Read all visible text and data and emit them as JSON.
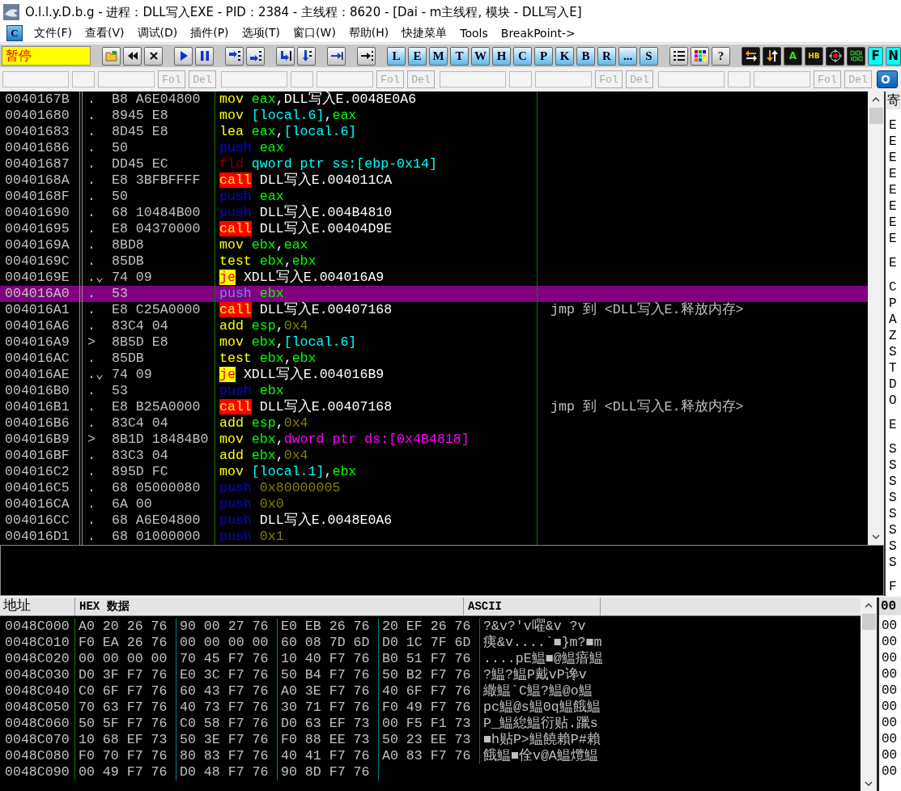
{
  "window": {
    "title": "O.l.l.y.D.b.g - 进程：DLL写入EXE - PID：2384 - 主线程：8620 - [Dai - m主线程, 模块 - DLL写入E]"
  },
  "menu": {
    "logo": "C",
    "items": [
      "文件(F)",
      "查看(V)",
      "调试(D)",
      "插件(P)",
      "选项(T)",
      "窗口(W)",
      "帮助(H)",
      "快捷菜单",
      "Tools",
      "BreakPoint->"
    ]
  },
  "toolbar": {
    "status": "暂停",
    "groups": [
      [
        {
          "kind": "open"
        },
        {
          "kind": "rewind"
        },
        {
          "kind": "close"
        }
      ],
      [
        {
          "kind": "run"
        },
        {
          "kind": "pause"
        }
      ],
      [
        {
          "kind": "step-into"
        },
        {
          "kind": "step-over"
        }
      ],
      [
        {
          "kind": "trace-into"
        },
        {
          "kind": "trace-over"
        }
      ],
      [
        {
          "kind": "till-return"
        }
      ],
      [
        {
          "kind": "goto"
        }
      ],
      [
        {
          "kind": "letter",
          "label": "L"
        },
        {
          "kind": "letter",
          "label": "E"
        },
        {
          "kind": "letter",
          "label": "M"
        },
        {
          "kind": "letter",
          "label": "T"
        },
        {
          "kind": "letter",
          "label": "W"
        },
        {
          "kind": "letter",
          "label": "H"
        },
        {
          "kind": "letter",
          "label": "C"
        },
        {
          "kind": "letter",
          "label": "P"
        },
        {
          "kind": "letter",
          "label": "K"
        },
        {
          "kind": "letter",
          "label": "B"
        },
        {
          "kind": "letter",
          "label": "R"
        },
        {
          "kind": "letter",
          "label": "..."
        },
        {
          "kind": "letter",
          "label": "S"
        }
      ],
      [
        {
          "kind": "list"
        },
        {
          "kind": "palette"
        },
        {
          "kind": "grey-letter",
          "label": "?"
        }
      ],
      [
        {
          "kind": "swap"
        },
        {
          "kind": "updown"
        },
        {
          "kind": "dark-letter",
          "label": "A"
        },
        {
          "kind": "dark-letter",
          "label": "HB"
        },
        {
          "kind": "target"
        },
        {
          "kind": "binary"
        },
        {
          "kind": "cyan-letter",
          "label": "F"
        },
        {
          "kind": "cyan-letter",
          "label": "N"
        }
      ]
    ]
  },
  "command_bar": {
    "groups": [
      {
        "buttons": [
          {
            "label": "Fol",
            "disabled": true
          },
          {
            "label": "Del",
            "disabled": true
          }
        ]
      },
      {
        "buttons": [
          {
            "label": "Fol",
            "disabled": true
          },
          {
            "label": "Del",
            "disabled": true
          }
        ]
      },
      {
        "buttons": [
          {
            "label": "Fol",
            "disabled": true
          },
          {
            "label": "Del",
            "disabled": true
          }
        ]
      },
      {
        "buttons": [
          {
            "label": "Fol",
            "disabled": true
          },
          {
            "label": "Del",
            "disabled": true
          }
        ]
      }
    ],
    "action_button": "O"
  },
  "disassembly": {
    "rows": [
      {
        "address": "0040167B",
        "mark": ".",
        "hex": "B8 A6E04800",
        "code": [
          {
            "kind": "op",
            "text": "mov"
          },
          {
            "kind": "reg",
            "text": "eax"
          },
          {
            "kind": "sep",
            "text": ","
          },
          {
            "kind": "sym",
            "text": "DLL写入E.0048E0A6"
          }
        ],
        "selected": false
      },
      {
        "address": "00401680",
        "mark": ".",
        "hex": "8945 E8",
        "code": [
          {
            "kind": "op",
            "text": "mov"
          },
          {
            "kind": "mem",
            "text": "[local.6]"
          },
          {
            "kind": "sep",
            "text": ","
          },
          {
            "kind": "reg",
            "text": "eax"
          }
        ],
        "selected": false
      },
      {
        "address": "00401683",
        "mark": ".",
        "hex": "8D45 E8",
        "code": [
          {
            "kind": "op",
            "text": "lea"
          },
          {
            "kind": "reg",
            "text": "eax"
          },
          {
            "kind": "sep",
            "text": ","
          },
          {
            "kind": "mem",
            "text": "[local.6]"
          }
        ],
        "selected": false
      },
      {
        "address": "00401686",
        "mark": ".",
        "hex": "50",
        "code": [
          {
            "kind": "push",
            "text": "push"
          },
          {
            "kind": "reg",
            "text": "eax"
          }
        ],
        "selected": false
      },
      {
        "address": "00401687",
        "mark": ".",
        "hex": "DD45 EC",
        "code": [
          {
            "kind": "fpu",
            "text": "fld"
          },
          {
            "kind": "mem",
            "text": "qword ptr ss:[ebp-0x14]"
          }
        ],
        "selected": false
      },
      {
        "address": "0040168A",
        "mark": ".",
        "hex": "E8 3BFBFFFF",
        "code": [
          {
            "kind": "call",
            "text": "call"
          },
          {
            "kind": "sym",
            "text": "DLL写入E.004011CA"
          }
        ],
        "selected": false
      },
      {
        "address": "0040168F",
        "mark": ".",
        "hex": "50",
        "code": [
          {
            "kind": "push",
            "text": "push"
          },
          {
            "kind": "reg",
            "text": "eax"
          }
        ],
        "selected": false
      },
      {
        "address": "00401690",
        "mark": ".",
        "hex": "68 10484B00",
        "code": [
          {
            "kind": "push",
            "text": "push"
          },
          {
            "kind": "sym",
            "text": "DLL写入E.004B4810"
          }
        ],
        "selected": false
      },
      {
        "address": "00401695",
        "mark": ".",
        "hex": "E8 04370000",
        "code": [
          {
            "kind": "call",
            "text": "call"
          },
          {
            "kind": "sym",
            "text": "DLL写入E.00404D9E"
          }
        ],
        "selected": false
      },
      {
        "address": "0040169A",
        "mark": ".",
        "hex": "8BD8",
        "code": [
          {
            "kind": "op",
            "text": "mov"
          },
          {
            "kind": "reg",
            "text": "ebx"
          },
          {
            "kind": "sep",
            "text": ","
          },
          {
            "kind": "reg",
            "text": "eax"
          }
        ],
        "selected": false
      },
      {
        "address": "0040169C",
        "mark": ".",
        "hex": "85DB",
        "code": [
          {
            "kind": "op",
            "text": "test"
          },
          {
            "kind": "reg",
            "text": "ebx"
          },
          {
            "kind": "sep",
            "text": ","
          },
          {
            "kind": "reg",
            "text": "ebx"
          }
        ],
        "selected": false
      },
      {
        "address": "0040169E",
        "mark": ".⌄",
        "hex": "74 09",
        "code": [
          {
            "kind": "jump",
            "text": "je"
          },
          {
            "kind": "sym",
            "text": "XDLL写入E.004016A9"
          }
        ],
        "selected": false
      },
      {
        "address": "004016A0",
        "mark": ".",
        "hex": "53",
        "code": [
          {
            "kind": "push",
            "text": "push"
          },
          {
            "kind": "reg",
            "text": "ebx"
          }
        ],
        "selected": true
      },
      {
        "address": "004016A1",
        "mark": ".",
        "hex": "E8 C25A0000",
        "code": [
          {
            "kind": "call",
            "text": "call"
          },
          {
            "kind": "sym",
            "text": "DLL写入E.00407168"
          }
        ],
        "comment": "jmp 到 <DLL写入E.释放内存>",
        "selected": false
      },
      {
        "address": "004016A6",
        "mark": ".",
        "hex": "83C4 04",
        "code": [
          {
            "kind": "op",
            "text": "add"
          },
          {
            "kind": "reg",
            "text": "esp"
          },
          {
            "kind": "sep",
            "text": ","
          },
          {
            "kind": "imm",
            "text": "0x4"
          }
        ],
        "selected": false
      },
      {
        "address": "004016A9",
        "mark": ">",
        "hex": "8B5D E8",
        "code": [
          {
            "kind": "op",
            "text": "mov"
          },
          {
            "kind": "reg",
            "text": "ebx"
          },
          {
            "kind": "sep",
            "text": ","
          },
          {
            "kind": "mem",
            "text": "[local.6]"
          }
        ],
        "selected": false
      },
      {
        "address": "004016AC",
        "mark": ".",
        "hex": "85DB",
        "code": [
          {
            "kind": "op",
            "text": "test"
          },
          {
            "kind": "reg",
            "text": "ebx"
          },
          {
            "kind": "sep",
            "text": ","
          },
          {
            "kind": "reg",
            "text": "ebx"
          }
        ],
        "selected": false
      },
      {
        "address": "004016AE",
        "mark": ".⌄",
        "hex": "74 09",
        "code": [
          {
            "kind": "jump",
            "text": "je"
          },
          {
            "kind": "sym",
            "text": "XDLL写入E.004016B9"
          }
        ],
        "selected": false
      },
      {
        "address": "004016B0",
        "mark": ".",
        "hex": "53",
        "code": [
          {
            "kind": "push",
            "text": "push"
          },
          {
            "kind": "reg",
            "text": "ebx"
          }
        ],
        "selected": false
      },
      {
        "address": "004016B1",
        "mark": ".",
        "hex": "E8 B25A0000",
        "code": [
          {
            "kind": "call",
            "text": "call"
          },
          {
            "kind": "sym",
            "text": "DLL写入E.00407168"
          }
        ],
        "comment": "jmp 到 <DLL写入E.释放内存>",
        "selected": false
      },
      {
        "address": "004016B6",
        "mark": ".",
        "hex": "83C4 04",
        "code": [
          {
            "kind": "op",
            "text": "add"
          },
          {
            "kind": "reg",
            "text": "esp"
          },
          {
            "kind": "sep",
            "text": ","
          },
          {
            "kind": "imm",
            "text": "0x4"
          }
        ],
        "selected": false
      },
      {
        "address": "004016B9",
        "mark": ">",
        "hex": "8B1D 18484B0",
        "code": [
          {
            "kind": "op",
            "text": "mov"
          },
          {
            "kind": "reg",
            "text": "ebx"
          },
          {
            "kind": "sep",
            "text": ","
          },
          {
            "kind": "ptr",
            "text": "dword ptr ds:[0x4B4818]"
          }
        ],
        "selected": false
      },
      {
        "address": "004016BF",
        "mark": ".",
        "hex": "83C3 04",
        "code": [
          {
            "kind": "op",
            "text": "add"
          },
          {
            "kind": "reg",
            "text": "ebx"
          },
          {
            "kind": "sep",
            "text": ","
          },
          {
            "kind": "imm",
            "text": "0x4"
          }
        ],
        "selected": false
      },
      {
        "address": "004016C2",
        "mark": ".",
        "hex": "895D FC",
        "code": [
          {
            "kind": "op",
            "text": "mov"
          },
          {
            "kind": "mem",
            "text": "[local.1]"
          },
          {
            "kind": "sep",
            "text": ","
          },
          {
            "kind": "reg",
            "text": "ebx"
          }
        ],
        "selected": false
      },
      {
        "address": "004016C5",
        "mark": ".",
        "hex": "68 05000080",
        "code": [
          {
            "kind": "push",
            "text": "push"
          },
          {
            "kind": "imm",
            "text": "0x80000005"
          }
        ],
        "selected": false
      },
      {
        "address": "004016CA",
        "mark": ".",
        "hex": "6A 00",
        "code": [
          {
            "kind": "push",
            "text": "push"
          },
          {
            "kind": "imm",
            "text": "0x0"
          }
        ],
        "selected": false
      },
      {
        "address": "004016CC",
        "mark": ".",
        "hex": "68 A6E04800",
        "code": [
          {
            "kind": "push",
            "text": "push"
          },
          {
            "kind": "sym",
            "text": "DLL写入E.0048E0A6"
          }
        ],
        "selected": false
      },
      {
        "address": "004016D1",
        "mark": ".",
        "hex": "68 01000000",
        "code": [
          {
            "kind": "push",
            "text": "push"
          },
          {
            "kind": "imm",
            "text": "0x1"
          }
        ],
        "selected": false
      }
    ]
  },
  "registers": {
    "header": "寄",
    "groups": [
      [
        "E",
        "E",
        "E",
        "E",
        "E",
        "E",
        "E",
        "E"
      ],
      [
        "E"
      ],
      [
        "C",
        "P",
        "A",
        "Z",
        "S",
        "T",
        "D",
        "O"
      ],
      [
        "E"
      ],
      [
        "S",
        "S",
        "S",
        "S",
        "S",
        "S",
        "S",
        "S"
      ],
      [
        "F"
      ]
    ]
  },
  "dump": {
    "columns": [
      "地址",
      "HEX 数据",
      "ASCII"
    ],
    "rows": [
      {
        "address": "0048C000",
        "hex": [
          "A0 20 26 76",
          "90 00 27 76",
          "E0 EB 26 76",
          "20 EF 26 76"
        ],
        "ascii": "?&v?'v嚁&v ?v"
      },
      {
        "address": "0048C010",
        "hex": [
          "F0 EA 26 76",
          "00 00 00 00",
          "60 08 7D 6D",
          "D0 1C 7F 6D"
        ],
        "ascii": "痍&v....`■}m?■m"
      },
      {
        "address": "0048C020",
        "hex": [
          "00 00 00 00",
          "70 45 F7 76",
          "10 40 F7 76",
          "B0 51 F7 76"
        ],
        "ascii": "....pE鰛■@鰛瘖鰛"
      },
      {
        "address": "0048C030",
        "hex": [
          "D0 3F F7 76",
          "E0 3C F7 76",
          "50 B4 F7 76",
          "50 B2 F7 76"
        ],
        "ascii": "?鰛?鰛P戴vP谗v"
      },
      {
        "address": "0048C040",
        "hex": [
          "C0 6F F7 76",
          "60 43 F7 76",
          "A0 3E F7 76",
          "40 6F F7 76"
        ],
        "ascii": "繖鰛`C鰛?鰛@o鰛"
      },
      {
        "address": "0048C050",
        "hex": [
          "70 63 F7 76",
          "40 73 F7 76",
          "30 71 F7 76",
          "F0 49 F7 76"
        ],
        "ascii": "pc鰛@s鰛0q鰛餓鰛"
      },
      {
        "address": "0048C060",
        "hex": [
          "50 5F F7 76",
          "C0 58 F7 76",
          "D0 63 EF 73",
          "00 F5 F1 73"
        ],
        "ascii": "P_鰛緿鰛衍贴.躐s"
      },
      {
        "address": "0048C070",
        "hex": [
          "10 68 EF 73",
          "50 3E F7 76",
          "F0 88 EE 73",
          "50 23 EE 73"
        ],
        "ascii": "■h贴P>鰛饒賴P#賴"
      },
      {
        "address": "0048C080",
        "hex": [
          "F0 70 F7 76",
          "80 83 F7 76",
          "40 41 F7 76",
          "A0 83 F7 76"
        ],
        "ascii": "餓鰛■佺v@A鰛爦鰛"
      },
      {
        "address": "0048C090",
        "hex": [
          "00 49 F7 76",
          "D0 48 F7 76",
          "90 8D F7 76"
        ]
      }
    ]
  },
  "stack": {
    "header": "00",
    "rows": [
      "00",
      "00",
      "00",
      "00",
      "00",
      "00",
      "00",
      "00",
      "00",
      "00"
    ]
  }
}
